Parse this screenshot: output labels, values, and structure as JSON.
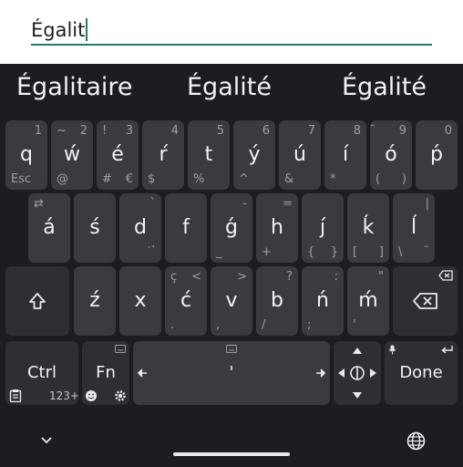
{
  "input": {
    "text": "Égalit"
  },
  "suggestions": [
    "Égalitaire",
    "Égalité",
    "Égalité"
  ],
  "row1": [
    {
      "main": "q",
      "tr": "1",
      "tl": "",
      "bl": "Esc",
      "br": ""
    },
    {
      "main": "ẃ",
      "tr": "2",
      "tl": "~",
      "bl": "@",
      "br": ""
    },
    {
      "main": "é",
      "tr": "3",
      "tl": "!",
      "bl": "#",
      "br": "€"
    },
    {
      "main": "ŕ",
      "tr": "4",
      "tl": "",
      "bl": "$",
      "br": ""
    },
    {
      "main": "t",
      "tr": "5",
      "tl": "",
      "bl": "%",
      "br": ""
    },
    {
      "main": "ý",
      "tr": "6",
      "tl": "",
      "bl": "^",
      "br": ""
    },
    {
      "main": "ú",
      "tr": "7",
      "tl": "",
      "bl": "&",
      "br": ""
    },
    {
      "main": "í",
      "tr": "8",
      "tl": "",
      "bl": "*",
      "br": ""
    },
    {
      "main": "ó",
      "tr": "9",
      "tl": "̑",
      "bl": "(",
      "br": ")"
    },
    {
      "main": "ṕ",
      "tr": "0",
      "tl": "",
      "bl": "",
      "br": ""
    }
  ],
  "row2": [
    {
      "main": "á",
      "tr": "",
      "tl": "⇄",
      "bl": "",
      "br": ""
    },
    {
      "main": "ś",
      "tr": "",
      "tl": "",
      "bl": "",
      "br": ""
    },
    {
      "main": "d",
      "tr": "`",
      "tl": "",
      "bl": "",
      "br": "̇  ̉"
    },
    {
      "main": "f",
      "tr": "",
      "tl": "",
      "bl": "",
      "br": ""
    },
    {
      "main": "ǵ",
      "tr": "-",
      "tl": "",
      "bl": "_",
      "br": ""
    },
    {
      "main": "h",
      "tr": "=",
      "tl": "",
      "bl": "+",
      "br": ""
    },
    {
      "main": "ȷ́",
      "tr": "",
      "tl": "",
      "bl": "{",
      "br": "}"
    },
    {
      "main": "ḱ",
      "tr": "",
      "tl": "",
      "bl": "[",
      "br": "]"
    },
    {
      "main": "ĺ",
      "tr": "|",
      "tl": "",
      "bl": "\\",
      "br": "̈"
    }
  ],
  "row3": [
    {
      "main": "ź",
      "tr": "",
      "tl": "",
      "bl": "",
      "br": ""
    },
    {
      "main": "x",
      "tr": "",
      "tl": "",
      "bl": "",
      "br": ""
    },
    {
      "main": "ć",
      "tr": "<",
      "tl": "ç",
      "bl": ".",
      "br": ""
    },
    {
      "main": "v",
      "tr": ">",
      "tl": "",
      "bl": ",",
      "br": ""
    },
    {
      "main": "b",
      "tr": "?",
      "tl": "",
      "bl": "/",
      "br": ""
    },
    {
      "main": "ń",
      "tr": ":",
      "tl": "",
      "bl": ";",
      "br": ""
    },
    {
      "main": "ḿ",
      "tr": "\"",
      "tl": "",
      "bl": "'",
      "br": ""
    }
  ],
  "bottom": {
    "ctrl": "Ctrl",
    "fn": "Fn",
    "fn_sub": "123+",
    "space_char": "'",
    "done": "Done"
  }
}
